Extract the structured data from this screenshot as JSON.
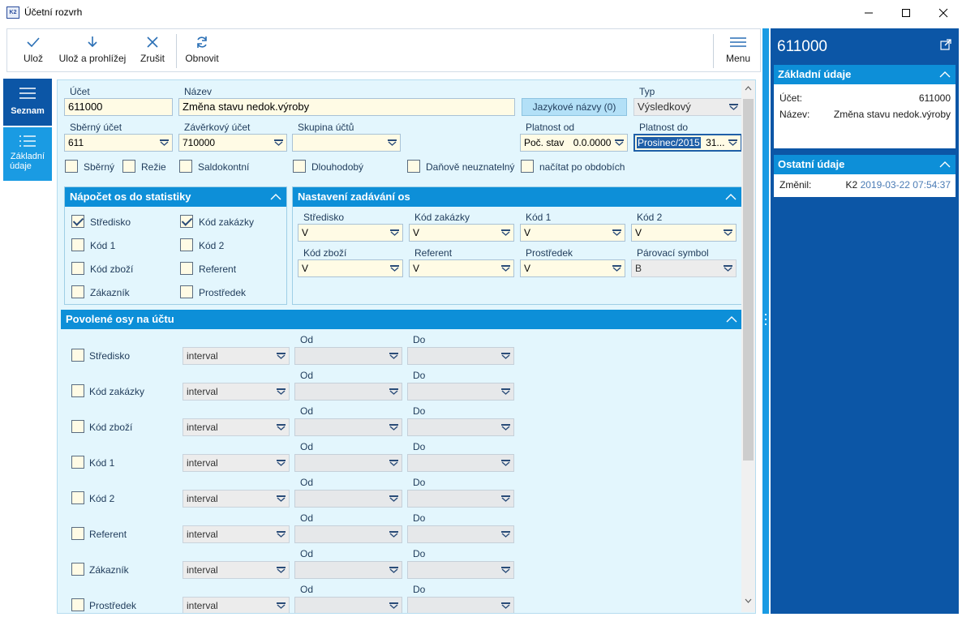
{
  "window": {
    "title": "Účetní rozvrh",
    "app_icon_text": "K2"
  },
  "toolbar": {
    "save_label": "Ulož",
    "save_view_label": "Ulož a prohlížej",
    "cancel_label": "Zrušit",
    "refresh_label": "Obnovit",
    "menu_label": "Menu"
  },
  "nav": {
    "list_label": "Seznam",
    "basic_label_1": "Základní",
    "basic_label_2": "údaje"
  },
  "account": {
    "ucet_label": "Účet",
    "ucet_value": "611000",
    "nazev_label": "Název",
    "nazev_value": "Změna stavu nedok.výroby",
    "lang_button": "Jazykové názvy (0)",
    "typ_label": "Typ",
    "typ_value": "Výsledkový",
    "sberny_label": "Sběrný účet",
    "sberny_value": "611",
    "zaverkovy_label": "Závěrkový účet",
    "zaverkovy_value": "710000",
    "skupina_label": "Skupina účtů",
    "skupina_value": "",
    "platnost_od_label": "Platnost od",
    "platnost_od_period": "Poč. stav",
    "platnost_od_date": "0.0.0000",
    "platnost_do_label": "Platnost do",
    "platnost_do_period": "Prosinec/2015",
    "platnost_do_date": "31..."
  },
  "flags": {
    "sberny": "Sběrný",
    "rezie": "Režie",
    "saldokontni": "Saldokontní",
    "dlouhodoby": "Dlouhodobý",
    "danove": "Daňově neuznatelný",
    "nacitat": "načítat po obdobích"
  },
  "napocet": {
    "title": "Nápočet os do statistiky",
    "items": [
      {
        "label": "Středisko",
        "checked": true
      },
      {
        "label": "Kód zakázky",
        "checked": true
      },
      {
        "label": "Kód 1",
        "checked": false
      },
      {
        "label": "Kód 2",
        "checked": false
      },
      {
        "label": "Kód zboží",
        "checked": false
      },
      {
        "label": "Referent",
        "checked": false
      },
      {
        "label": "Zákazník",
        "checked": false
      },
      {
        "label": "Prostředek",
        "checked": false
      }
    ]
  },
  "nastaveni": {
    "title": "Nastavení zadávání os",
    "fields": [
      {
        "label": "Středisko",
        "value": "V"
      },
      {
        "label": "Kód zakázky",
        "value": "V"
      },
      {
        "label": "Kód 1",
        "value": "V"
      },
      {
        "label": "Kód 2",
        "value": "V"
      },
      {
        "label": "Kód zboží",
        "value": "V"
      },
      {
        "label": "Referent",
        "value": "V"
      },
      {
        "label": "Prostředek",
        "value": "V"
      },
      {
        "label": "Párovací symbol",
        "value": "B"
      }
    ]
  },
  "povolene": {
    "title": "Povolené osy na účtu",
    "od_label": "Od",
    "do_label": "Do",
    "rows": [
      {
        "label": "Středisko",
        "mode": "interval"
      },
      {
        "label": "Kód zakázky",
        "mode": "interval"
      },
      {
        "label": "Kód zboží",
        "mode": "interval"
      },
      {
        "label": "Kód 1",
        "mode": "interval"
      },
      {
        "label": "Kód 2",
        "mode": "interval"
      },
      {
        "label": "Referent",
        "mode": "interval"
      },
      {
        "label": "Zákazník",
        "mode": "interval"
      },
      {
        "label": "Prostředek",
        "mode": "interval"
      }
    ]
  },
  "right": {
    "header": "611000",
    "basic_title": "Základní údaje",
    "ucet_label": "Účet:",
    "ucet_value": "611000",
    "nazev_label": "Název:",
    "nazev_value": "Změna stavu nedok.výroby",
    "other_title": "Ostatní údaje",
    "changed_label": "Změnil:",
    "changed_user": "K2",
    "changed_date": "2019-03-22 07:54:37"
  },
  "colors": {
    "accent": "#0d8fd8",
    "nav_dark": "#0c56a6",
    "field_yellow": "#fffbe5",
    "form_bg": "#e3f6fd"
  }
}
